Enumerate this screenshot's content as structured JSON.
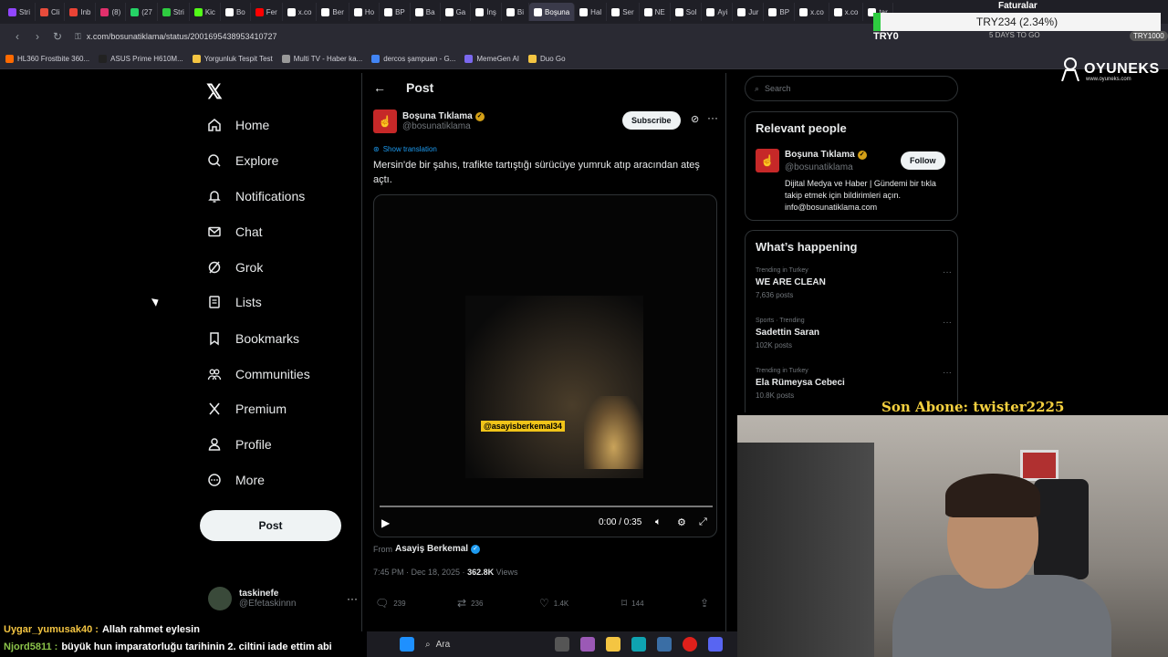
{
  "browser": {
    "tabs": [
      {
        "label": "Stri",
        "color": "#9146ff"
      },
      {
        "label": "Cli",
        "color": "#e74c3c"
      },
      {
        "label": "Inb",
        "color": "#ea4335"
      },
      {
        "label": "(8)",
        "color": "#e1306c"
      },
      {
        "label": "(27",
        "color": "#25d366"
      },
      {
        "label": "Stri",
        "color": "#2ecc40"
      },
      {
        "label": "Kic",
        "color": "#53fc18"
      },
      {
        "label": "Bo",
        "color": "#ffffff"
      },
      {
        "label": "Fer",
        "color": "#ff0000"
      },
      {
        "label": "x.co",
        "color": "#ffffff"
      },
      {
        "label": "Ber",
        "color": "#ffffff"
      },
      {
        "label": "Ho",
        "color": "#ffffff"
      },
      {
        "label": "BP",
        "color": "#ffffff"
      },
      {
        "label": "Ba",
        "color": "#ffffff"
      },
      {
        "label": "Ga",
        "color": "#ffffff"
      },
      {
        "label": "İnş",
        "color": "#ffffff"
      },
      {
        "label": "Bi",
        "color": "#ffffff"
      },
      {
        "label": "Boşuna",
        "color": "#ffffff",
        "active": true
      },
      {
        "label": "Hal",
        "color": "#ffffff"
      },
      {
        "label": "Ser",
        "color": "#ffffff"
      },
      {
        "label": "NE",
        "color": "#ffffff"
      },
      {
        "label": "Sol",
        "color": "#ffffff"
      },
      {
        "label": "Ayi",
        "color": "#ffffff"
      },
      {
        "label": "Jur",
        "color": "#ffffff"
      },
      {
        "label": "BP",
        "color": "#ffffff"
      },
      {
        "label": "x.co",
        "color": "#ffffff"
      },
      {
        "label": "x.co",
        "color": "#ffffff"
      },
      {
        "label": "tar",
        "color": "#ffffff"
      }
    ],
    "url": "x.com/bosunatiklama/status/2001695438953410727",
    "bookmarks": [
      {
        "label": "HL360 Frostbite 360...",
        "color": "#ff6a00"
      },
      {
        "label": "ASUS Prime H610M...",
        "color": "#222222"
      },
      {
        "label": "Yorgunluk Tespit Test",
        "color": "#f4c542"
      },
      {
        "label": "Multi TV - Haber ka...",
        "color": "#999999"
      },
      {
        "label": "dercos şampuan - G...",
        "color": "#4285f4"
      },
      {
        "label": "MemeGen AI",
        "color": "#7b68ee"
      },
      {
        "label": "Duo Go",
        "color": "#f4c542"
      }
    ]
  },
  "overlay": {
    "ticker": "TRY234 (2.34%)",
    "faturalar": "Faturalar",
    "try0": "TRY0",
    "days": "5 DAYS TO GO",
    "try_badge": "TRY1000",
    "oyuneks_brand": "OYUNEKS",
    "oyuneks_url": "www.oyuneks.com",
    "son_abone": "Son Abone: twister2225",
    "chat": [
      {
        "nick": "Uygar_yumusak40 :",
        "text": "Allah rahmet eylesin"
      },
      {
        "nick": "Njord5811 :",
        "text": "büyük hun imparatorluğu tarihinin 2. ciltini iade ettim abi"
      }
    ]
  },
  "taskbar": {
    "search_label": "Ara"
  },
  "nav": {
    "items": [
      {
        "label": "Home",
        "icon": "home-icon"
      },
      {
        "label": "Explore",
        "icon": "search-icon"
      },
      {
        "label": "Notifications",
        "icon": "bell-icon"
      },
      {
        "label": "Chat",
        "icon": "mail-icon"
      },
      {
        "label": "Grok",
        "icon": "grok-icon"
      },
      {
        "label": "Lists",
        "icon": "list-icon"
      },
      {
        "label": "Bookmarks",
        "icon": "bookmark-icon"
      },
      {
        "label": "Communities",
        "icon": "people-icon"
      },
      {
        "label": "Premium",
        "icon": "x-icon"
      },
      {
        "label": "Profile",
        "icon": "person-icon"
      },
      {
        "label": "More",
        "icon": "more-icon"
      }
    ],
    "post_button": "Post",
    "account": {
      "name": "taskinefe",
      "handle": "@Efetaskinnn"
    }
  },
  "post": {
    "header_title": "Post",
    "author_name": "Boşuna Tıklama",
    "author_handle": "@bosunatiklama",
    "subscribe_label": "Subscribe",
    "show_translation": "Show translation",
    "text": "Mersin'de bir şahıs, trafikte tartıştığı sürücüye yumruk atıp aracından ateş açtı.",
    "video_watermark": "@asayisberkemal34",
    "video_time": "0:00 / 0:35",
    "video_progress": 0,
    "from_prefix": "From",
    "from_name": "Asayiş Berkemal",
    "timestamp": "7:45 PM · Dec 18, 2025 ·",
    "views_count": "362.8K",
    "views_label": "Views",
    "replies": "239",
    "reposts": "236",
    "likes": "1.4K",
    "bookmarks": "144"
  },
  "sidebar": {
    "search_placeholder": "Search",
    "relevant_title": "Relevant people",
    "relevant_person": {
      "name": "Boşuna Tıklama",
      "handle": "@bosunatiklama",
      "follow_label": "Follow",
      "bio": "Dijital Medya ve Haber | Gündemi bir tıkla takip etmek için bildirimleri açın. info@bosunatiklama.com"
    },
    "happening_title": "What’s happening",
    "trends": [
      {
        "category": "Trending in Turkey",
        "name": "WE ARE CLEAN",
        "count": "7,636 posts"
      },
      {
        "category": "Sports · Trending",
        "name": "Sadettin Saran",
        "count": "102K posts"
      },
      {
        "category": "Trending in Turkey",
        "name": "Ela Rümeysa Cebeci",
        "count": "10.8K posts"
      }
    ]
  }
}
